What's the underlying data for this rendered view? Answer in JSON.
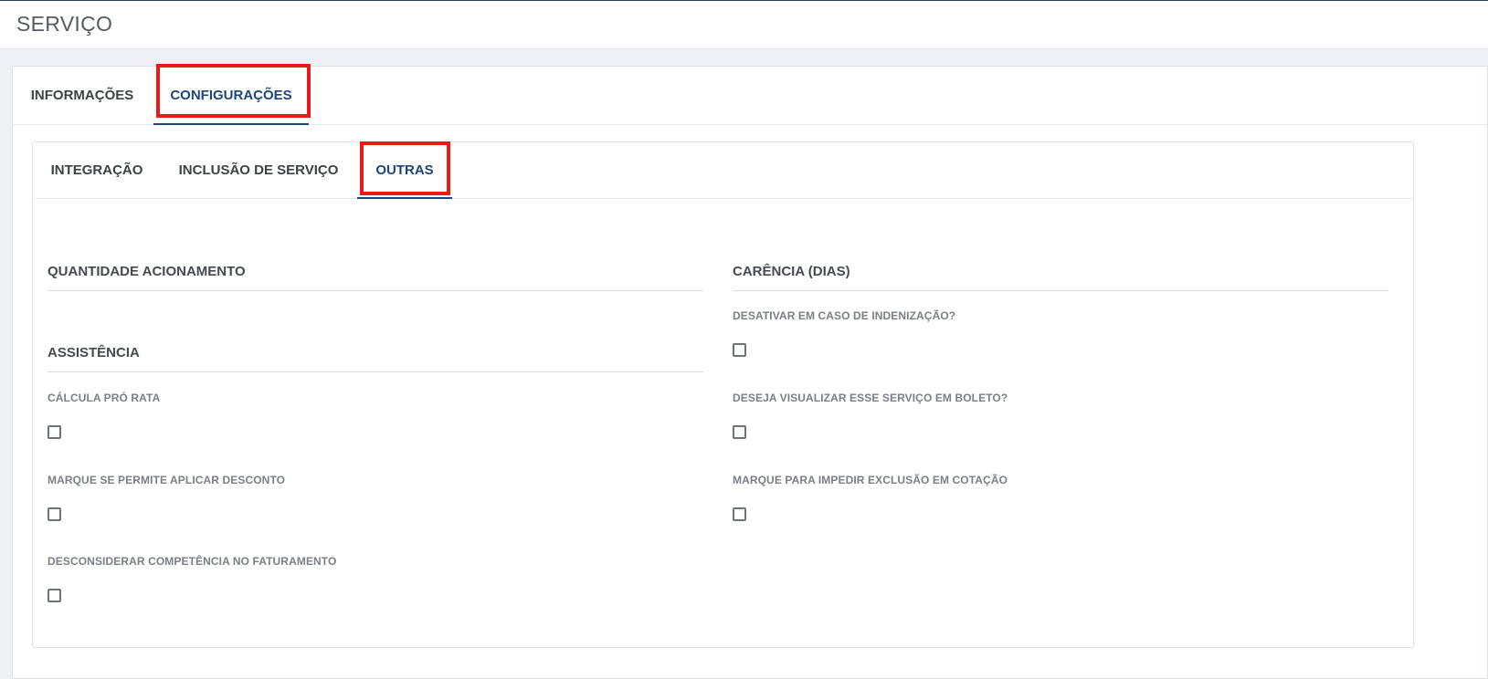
{
  "header": {
    "title": "SERVIÇO"
  },
  "main_tabs": [
    {
      "label": "INFORMAÇÕES",
      "active": false
    },
    {
      "label": "CONFIGURAÇÕES",
      "active": true
    }
  ],
  "sub_tabs": [
    {
      "label": "INTEGRAÇÃO",
      "active": false
    },
    {
      "label": "INCLUSÃO DE SERVIÇO",
      "active": false
    },
    {
      "label": "OUTRAS",
      "active": true
    }
  ],
  "left_column": {
    "quantidade_title": "QUANTIDADE ACIONAMENTO",
    "assistencia_title": "ASSISTÊNCIA",
    "fields": [
      {
        "label": "CÁLCULA PRÓ RATA",
        "checked": false
      },
      {
        "label": "MARQUE SE PERMITE APLICAR DESCONTO",
        "checked": false
      },
      {
        "label": "DESCONSIDERAR COMPETÊNCIA NO FATURAMENTO",
        "checked": false
      }
    ]
  },
  "right_column": {
    "carencia_title": "CARÊNCIA (DIAS)",
    "fields": [
      {
        "label": "DESATIVAR EM CASO DE INDENIZAÇÃO?",
        "checked": false
      },
      {
        "label": "DESEJA VISUALIZAR ESSE SERVIÇO EM BOLETO?",
        "checked": false
      },
      {
        "label": "MARQUE PARA IMPEDIR EXCLUSÃO EM COTAÇÃO",
        "checked": false
      }
    ]
  },
  "colors": {
    "highlight": "#ea1a1a",
    "active_tab": "#1c4578"
  }
}
